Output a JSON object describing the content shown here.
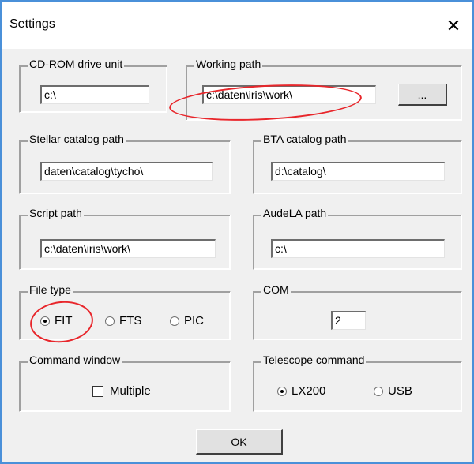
{
  "window": {
    "title": "Settings",
    "close_glyph": "✕"
  },
  "groups": {
    "cdrom": {
      "label": "CD-ROM drive unit",
      "value": "c:\\"
    },
    "working": {
      "label": "Working path",
      "value": "c:\\daten\\iris\\work\\",
      "browse_label": "..."
    },
    "stellar": {
      "label": "Stellar catalog path",
      "value": "daten\\catalog\\tycho\\"
    },
    "bta": {
      "label": "BTA catalog path",
      "value": "d:\\catalog\\"
    },
    "script": {
      "label": "Script path",
      "value": "c:\\daten\\iris\\work\\"
    },
    "audela": {
      "label": "AudeLA path",
      "value": "c:\\"
    },
    "filetype": {
      "label": "File type",
      "options": [
        {
          "label": "FIT",
          "checked": true
        },
        {
          "label": "FTS",
          "checked": false
        },
        {
          "label": "PIC",
          "checked": false
        }
      ]
    },
    "com": {
      "label": "COM",
      "value": "2"
    },
    "cmdwindow": {
      "label": "Command window",
      "checkbox_label": "Multiple",
      "checked": false
    },
    "telescope": {
      "label": "Telescope command",
      "options": [
        {
          "label": "LX200",
          "checked": true
        },
        {
          "label": "USB",
          "checked": false
        }
      ]
    }
  },
  "ok_label": "OK",
  "annotation_color": "#e8262b"
}
